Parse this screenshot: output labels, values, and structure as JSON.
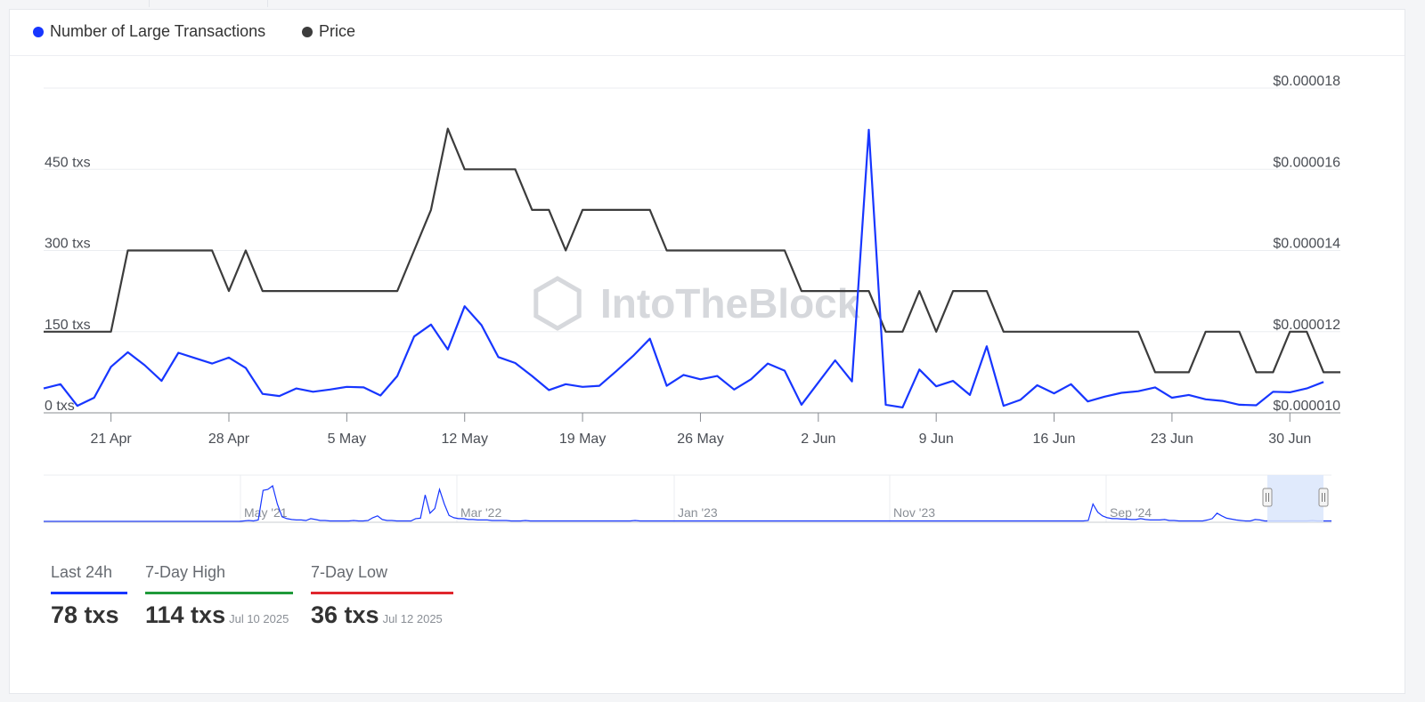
{
  "legend": [
    {
      "label": "Number of Large Transactions",
      "color": "#1736ff"
    },
    {
      "label": "Price",
      "color": "#3c3c3c"
    }
  ],
  "watermark": "IntoTheBlock",
  "chart_data": {
    "type": "line",
    "x": [
      "2025-04-17",
      "2025-04-18",
      "2025-04-19",
      "2025-04-20",
      "2025-04-21",
      "2025-04-22",
      "2025-04-23",
      "2025-04-24",
      "2025-04-25",
      "2025-04-26",
      "2025-04-27",
      "2025-04-28",
      "2025-04-29",
      "2025-04-30",
      "2025-05-01",
      "2025-05-02",
      "2025-05-03",
      "2025-05-04",
      "2025-05-05",
      "2025-05-06",
      "2025-05-07",
      "2025-05-08",
      "2025-05-09",
      "2025-05-10",
      "2025-05-11",
      "2025-05-12",
      "2025-05-13",
      "2025-05-14",
      "2025-05-15",
      "2025-05-16",
      "2025-05-17",
      "2025-05-18",
      "2025-05-19",
      "2025-05-20",
      "2025-05-21",
      "2025-05-22",
      "2025-05-23",
      "2025-05-24",
      "2025-05-25",
      "2025-05-26",
      "2025-05-27",
      "2025-05-28",
      "2025-05-29",
      "2025-05-30",
      "2025-05-31",
      "2025-06-01",
      "2025-06-02",
      "2025-06-03",
      "2025-06-04",
      "2025-06-05",
      "2025-06-06",
      "2025-06-07",
      "2025-06-08",
      "2025-06-09",
      "2025-06-10",
      "2025-06-11",
      "2025-06-12",
      "2025-06-13",
      "2025-06-14",
      "2025-06-15",
      "2025-06-16",
      "2025-06-17",
      "2025-06-18",
      "2025-06-19",
      "2025-06-20",
      "2025-06-21",
      "2025-06-22",
      "2025-06-23",
      "2025-06-24",
      "2025-06-25",
      "2025-06-26",
      "2025-06-27",
      "2025-06-28",
      "2025-06-29",
      "2025-06-30",
      "2025-07-01",
      "2025-07-02",
      "2025-07-03"
    ],
    "series": [
      {
        "name": "Number of Large Transactions",
        "axis": "left",
        "color": "#1736ff",
        "values": [
          45,
          53,
          13,
          28,
          85,
          112,
          88,
          59,
          111,
          101,
          91,
          102,
          83,
          35,
          31,
          45,
          39,
          43,
          48,
          47,
          32,
          68,
          141,
          163,
          117,
          197,
          162,
          103,
          92,
          68,
          42,
          53,
          48,
          50,
          77,
          105,
          137,
          50,
          70,
          62,
          68,
          43,
          62,
          91,
          78,
          15,
          56,
          97,
          58,
          523,
          15,
          10,
          80,
          49,
          59,
          33,
          123,
          13,
          24,
          51,
          36,
          53,
          21,
          30,
          37,
          40,
          47,
          28,
          33,
          25,
          22,
          15,
          14,
          39,
          38,
          45,
          57
        ]
      },
      {
        "name": "Price",
        "axis": "right",
        "color": "#3c3c3c",
        "values": [
          1.2e-05,
          1.2e-05,
          1.2e-05,
          1.2e-05,
          1.2e-05,
          1.4e-05,
          1.4e-05,
          1.4e-05,
          1.4e-05,
          1.4e-05,
          1.4e-05,
          1.3e-05,
          1.4e-05,
          1.3e-05,
          1.3e-05,
          1.3e-05,
          1.3e-05,
          1.3e-05,
          1.3e-05,
          1.3e-05,
          1.3e-05,
          1.3e-05,
          1.4e-05,
          1.5e-05,
          1.7e-05,
          1.6e-05,
          1.6e-05,
          1.6e-05,
          1.6e-05,
          1.5e-05,
          1.5e-05,
          1.4e-05,
          1.5e-05,
          1.5e-05,
          1.5e-05,
          1.5e-05,
          1.5e-05,
          1.4e-05,
          1.4e-05,
          1.4e-05,
          1.4e-05,
          1.4e-05,
          1.4e-05,
          1.4e-05,
          1.4e-05,
          1.3e-05,
          1.3e-05,
          1.3e-05,
          1.3e-05,
          1.3e-05,
          1.2e-05,
          1.2e-05,
          1.3e-05,
          1.2e-05,
          1.3e-05,
          1.3e-05,
          1.3e-05,
          1.2e-05,
          1.2e-05,
          1.2e-05,
          1.2e-05,
          1.2e-05,
          1.2e-05,
          1.2e-05,
          1.2e-05,
          1.2e-05,
          1.1e-05,
          1.1e-05,
          1.1e-05,
          1.2e-05,
          1.2e-05,
          1.2e-05,
          1.1e-05,
          1.1e-05,
          1.2e-05,
          1.2e-05,
          1.1e-05,
          1.1e-05,
          1.2e-05,
          1.2e-05
        ]
      }
    ],
    "x_ticks": [
      {
        "date": "2025-04-21",
        "label": "21 Apr"
      },
      {
        "date": "2025-04-28",
        "label": "28 Apr"
      },
      {
        "date": "2025-05-05",
        "label": "5 May"
      },
      {
        "date": "2025-05-12",
        "label": "12 May"
      },
      {
        "date": "2025-05-19",
        "label": "19 May"
      },
      {
        "date": "2025-05-26",
        "label": "26 May"
      },
      {
        "date": "2025-06-02",
        "label": "2 Jun"
      },
      {
        "date": "2025-06-09",
        "label": "9 Jun"
      },
      {
        "date": "2025-06-16",
        "label": "16 Jun"
      },
      {
        "date": "2025-06-23",
        "label": "23 Jun"
      },
      {
        "date": "2025-06-30",
        "label": "30 Jun"
      }
    ],
    "y_left": {
      "ticks": [
        0,
        150,
        300,
        450
      ],
      "tick_labels": [
        "0 txs",
        "150 txs",
        "300 txs",
        "450 txs"
      ],
      "range": [
        0,
        600
      ]
    },
    "y_right": {
      "ticks": [
        1e-05,
        1.2e-05,
        1.4e-05,
        1.6e-05,
        1.8e-05
      ],
      "tick_labels": [
        "$0.000010",
        "$0.000012",
        "$0.000014",
        "$0.000016",
        "$0.000018"
      ],
      "range": [
        1e-05,
        1.8e-05
      ]
    },
    "grid": true,
    "legend_position": "top-left"
  },
  "navigator": {
    "labels": [
      "May '21",
      "Mar '22",
      "Jan '23",
      "Nov '23",
      "Sep '24"
    ],
    "series": [
      2,
      2,
      2,
      2,
      2,
      2,
      2,
      2,
      2,
      2,
      2,
      2,
      2,
      2,
      2,
      2,
      2,
      2,
      2,
      2,
      2,
      2,
      2,
      2,
      2,
      2,
      2,
      2,
      2,
      2,
      2,
      2,
      2,
      2,
      2,
      2,
      2,
      2,
      2,
      2,
      2,
      2,
      3,
      4,
      3,
      5,
      70,
      72,
      80,
      40,
      12,
      8,
      6,
      5,
      5,
      4,
      8,
      6,
      4,
      4,
      3,
      3,
      3,
      3,
      3,
      4,
      3,
      3,
      4,
      10,
      14,
      6,
      4,
      4,
      3,
      3,
      3,
      3,
      8,
      9,
      60,
      20,
      30,
      72,
      40,
      15,
      10,
      8,
      8,
      6,
      6,
      5,
      5,
      5,
      4,
      4,
      4,
      4,
      3,
      3,
      3,
      4,
      3,
      3,
      3,
      3,
      3,
      3,
      3,
      3,
      3,
      3,
      3,
      3,
      3,
      3,
      3,
      3,
      3,
      3,
      3,
      3,
      3,
      3,
      4,
      3,
      3,
      3,
      3,
      3,
      3,
      3,
      3,
      3,
      3,
      3,
      3,
      3,
      3,
      3,
      3,
      3,
      3,
      3,
      3,
      3,
      3,
      3,
      3,
      3,
      3,
      3,
      3,
      3,
      3,
      3,
      3,
      3,
      3,
      3,
      3,
      3,
      3,
      3,
      3,
      3,
      3,
      3,
      3,
      3,
      3,
      3,
      3,
      3,
      3,
      3,
      3,
      3,
      3,
      3,
      3,
      3,
      3,
      3,
      3,
      3,
      3,
      3,
      3,
      3,
      3,
      3,
      3,
      3,
      3,
      3,
      3,
      3,
      3,
      3,
      3,
      3,
      3,
      3,
      3,
      3,
      3,
      3,
      3,
      3,
      3,
      3,
      3,
      3,
      3,
      3,
      3,
      3,
      3,
      4,
      40,
      22,
      14,
      10,
      8,
      8,
      7,
      7,
      6,
      6,
      8,
      6,
      5,
      5,
      5,
      6,
      4,
      4,
      3,
      3,
      3,
      3,
      3,
      3,
      5,
      8,
      20,
      14,
      9,
      7,
      5,
      4,
      3,
      3,
      6,
      5,
      3,
      3,
      3,
      3,
      3,
      3,
      3,
      3,
      3,
      3,
      4,
      3,
      3,
      3,
      3
    ]
  },
  "stats": [
    {
      "label": "Last 24h",
      "value": "78 txs",
      "date": "",
      "color": "#1736ff"
    },
    {
      "label": "7-Day High",
      "value": "114 txs",
      "date": "Jul 10 2025",
      "color": "#1f9a3a"
    },
    {
      "label": "7-Day Low",
      "value": "36 txs",
      "date": "Jul 12 2025",
      "color": "#e0262d"
    }
  ]
}
